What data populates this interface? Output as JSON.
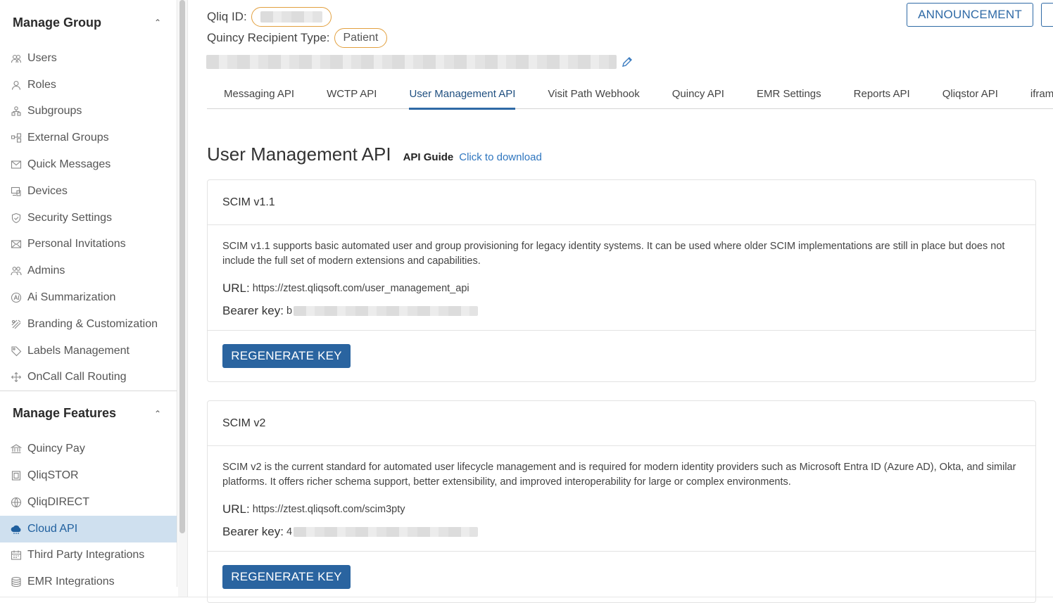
{
  "sidebar": {
    "group1_title": "Manage Group",
    "group1_items": [
      {
        "label": "Users",
        "icon": "users-icon"
      },
      {
        "label": "Roles",
        "icon": "user-icon"
      },
      {
        "label": "Subgroups",
        "icon": "subgroups-icon"
      },
      {
        "label": "External Groups",
        "icon": "external-groups-icon"
      },
      {
        "label": "Quick Messages",
        "icon": "message-icon"
      },
      {
        "label": "Devices",
        "icon": "devices-icon"
      },
      {
        "label": "Security Settings",
        "icon": "shield-icon"
      },
      {
        "label": "Personal Invitations",
        "icon": "envelope-icon"
      },
      {
        "label": "Admins",
        "icon": "admins-icon"
      },
      {
        "label": "Ai Summarization",
        "icon": "ai-icon"
      },
      {
        "label": "Branding & Customization",
        "icon": "branding-icon"
      },
      {
        "label": "Labels Management",
        "icon": "tag-icon"
      },
      {
        "label": "OnCall Call Routing",
        "icon": "routing-icon"
      }
    ],
    "group2_title": "Manage Features",
    "group2_items": [
      {
        "label": "Quincy Pay",
        "icon": "bank-icon"
      },
      {
        "label": "QliqSTOR",
        "icon": "storage-icon"
      },
      {
        "label": "QliqDIRECT",
        "icon": "globe-icon"
      },
      {
        "label": "Cloud API",
        "icon": "cloud-icon",
        "active": true
      },
      {
        "label": "Third Party Integrations",
        "icon": "calendar-icon"
      },
      {
        "label": "EMR Integrations",
        "icon": "database-icon"
      }
    ]
  },
  "header": {
    "qliq_id_label": "Qliq ID:",
    "recipient_type_label": "Quincy Recipient Type:",
    "recipient_type_value": "Patient",
    "announcement_label": "ANNOUNCEMENT"
  },
  "tabs": [
    "Messaging API",
    "WCTP API",
    "User Management API",
    "Visit Path Webhook",
    "Quincy API",
    "EMR Settings",
    "Reports API",
    "Qliqstor API",
    "iframe AP"
  ],
  "active_tab": "User Management API",
  "page": {
    "title": "User Management API",
    "guide_label": "API Guide",
    "guide_link": "Click to download"
  },
  "cards": [
    {
      "title": "SCIM v1.1",
      "description": "SCIM v1.1 supports basic automated user and group provisioning for legacy identity systems. It can be used where older SCIM implementations are still in place but does not include the full set of modern extensions and capabilities.",
      "url_label": "URL:",
      "url_value": "https://ztest.qliqsoft.com/user_management_api",
      "key_label": "Bearer key:",
      "key_prefix": "b",
      "button_label": "REGENERATE KEY"
    },
    {
      "title": "SCIM v2",
      "description": "SCIM v2 is the current standard for automated user lifecycle management and is required for modern identity providers such as Microsoft Entra ID (Azure AD), Okta, and similar platforms. It offers richer schema support, better extensibility, and improved interoperability for large or complex environments.",
      "url_label": "URL:",
      "url_value": "https://ztest.qliqsoft.com/scim3pty",
      "key_label": "Bearer key:",
      "key_prefix": "4",
      "button_label": "REGENERATE KEY"
    }
  ],
  "colors": {
    "accent": "#2a64a0",
    "active_bg": "#cfe0ef",
    "pill_border": "#e2a03f"
  }
}
